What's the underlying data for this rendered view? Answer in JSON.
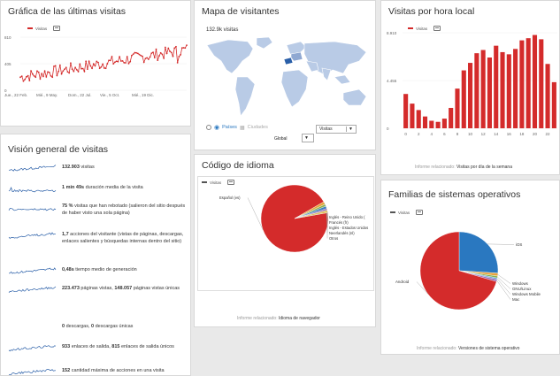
{
  "colors": {
    "accent": "#d42b2b",
    "ios_blue": "#2a78c0",
    "map_land": "#b9cbe6",
    "map_dark": "#2a5fa8"
  },
  "line_widget": {
    "title": "Gráfica de las últimas visitas",
    "legend": "Visitas",
    "chart_data": {
      "type": "line",
      "y_ticks": [
        "810",
        "405",
        "0"
      ],
      "x_labels": [
        "Jue., 22 Feb.",
        "Mié., 9 May.",
        "Dom., 22 Jul.",
        "Vie., 5 Oct.",
        "Mié., 19 Dic."
      ],
      "ylim": [
        0,
        810
      ],
      "start": 200,
      "end": 620,
      "count": 110
    }
  },
  "map_widget": {
    "title": "Mapa de visitantes",
    "visits": "132.9k visitas",
    "radio_countries": "Países",
    "radio_cities": "Ciudades",
    "metric_select": "Visitas",
    "region_select": "Global"
  },
  "hour_widget": {
    "title": "Visitas por hora local",
    "legend": "Visitas",
    "chart_data": {
      "type": "bar",
      "y_ticks": [
        "8.910",
        "4.455",
        "0"
      ],
      "ylim": [
        0,
        8910
      ],
      "categories": [
        "0",
        "1",
        "2",
        "3",
        "4",
        "5",
        "6",
        "7",
        "8",
        "9",
        "10",
        "11",
        "12",
        "13",
        "14",
        "15",
        "16",
        "17",
        "18",
        "19",
        "20",
        "21",
        "22",
        "23"
      ],
      "x_tick_labels": [
        "0",
        "2",
        "4",
        "6",
        "8",
        "10",
        "12",
        "14",
        "16",
        "18",
        "20",
        "22"
      ],
      "values": [
        3200,
        2300,
        1700,
        1100,
        700,
        600,
        900,
        1900,
        3700,
        5400,
        6100,
        7000,
        7300,
        6600,
        7700,
        7100,
        6900,
        7400,
        8200,
        8400,
        8700,
        8300,
        6000,
        4300
      ]
    },
    "related_prefix": "Informe relacionado:",
    "related_link": "Visitas por día de la semana"
  },
  "overview_widget": {
    "title": "Visión general de visitas",
    "rows": [
      {
        "bold": "132.903",
        "text": " visitas"
      },
      {
        "bold": "1 min 49s",
        "text": " duración media de la visita"
      },
      {
        "bold": "75 %",
        "text": " visitas que han rebotado (salieron del sitio después de haber visto una sola página)"
      },
      {
        "bold": "1,7",
        "text": " acciones del visitante (vistas de páginas, descargas, enlaces salientes y búsquedas internas dentro del sitio)"
      },
      {
        "bold": "0,48s",
        "text": " tiempo medio de generación"
      },
      {
        "bold": "223.473",
        "text": " páginas vistas, ",
        "bold2": "148.057",
        "text2": " páginas vistas únicas"
      },
      {
        "bold": "0",
        "text": " descargas, ",
        "bold2": "0",
        "text2": " descargas únicas"
      },
      {
        "bold": "933",
        "text": " enlaces de salida, ",
        "bold2": "815",
        "text2": " enlaces de salida únicos"
      },
      {
        "bold": "152",
        "text": " cantidad máxima de acciones en una visita"
      }
    ]
  },
  "lang_widget": {
    "title": "Código de idioma",
    "legend": "Visitas",
    "chart_data": {
      "type": "pie",
      "labels": [
        "Español (es)",
        "Inglés - Reino Unido (en-gb)",
        "Francés (fr)",
        "Inglés - Estados Unidos (en-us)",
        "Neerlandés (nl)",
        "Otros"
      ],
      "label_texts": [
        "Español (es)",
        "Inglés - Reino Unido (",
        "Francés (fr)",
        "Inglés - Estados Unidos",
        "Neerlandés (nl)",
        "Otros"
      ],
      "values": [
        94.5,
        1.3,
        1.0,
        1.2,
        0.8,
        1.2
      ],
      "colors": [
        "#d42b2b",
        "#e8a33b",
        "#8ab04d",
        "#3c7fc0",
        "#8a62b0",
        "#e0c060"
      ]
    },
    "related_prefix": "Informe relacionado:",
    "related_link": "Idioma de navegador"
  },
  "os_widget": {
    "title": "Familias de sistemas operativos",
    "legend": "Visitas",
    "chart_data": {
      "type": "pie",
      "labels": [
        "iOS",
        "Windows",
        "GNU/Linux",
        "Windows Mobile",
        "Mac",
        "Android"
      ],
      "values": [
        26,
        1.2,
        0.8,
        0.6,
        0.9,
        70.5
      ],
      "colors": [
        "#2a78c0",
        "#e8a33b",
        "#8ab04d",
        "#5aa0d8",
        "#9a6ab8",
        "#d42b2b"
      ]
    },
    "related_prefix": "Informe relacionado:",
    "related_link": "Versiones de sistema operativo"
  }
}
